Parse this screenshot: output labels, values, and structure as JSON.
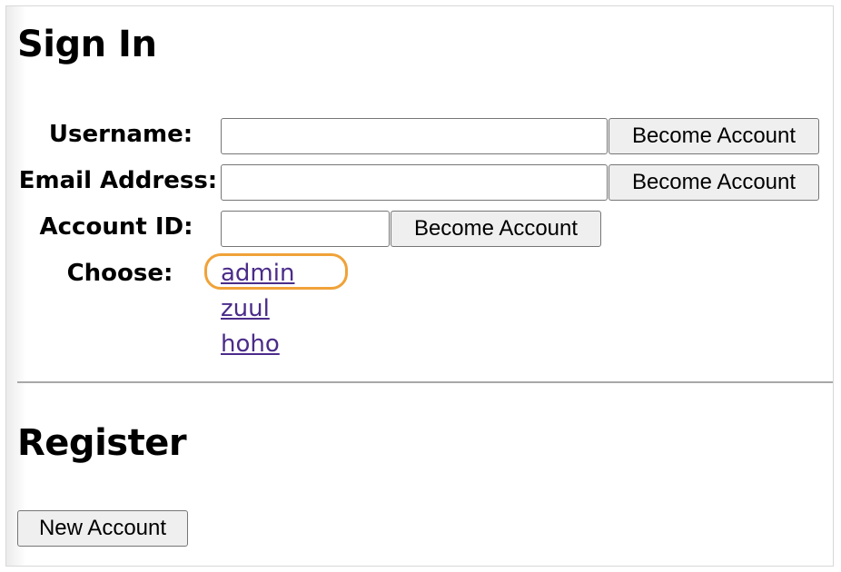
{
  "signin": {
    "title": "Sign In",
    "fields": {
      "username": {
        "label": "Username:",
        "value": "",
        "button": "Become Account"
      },
      "email": {
        "label": "Email Address:",
        "value": "",
        "button": "Become Account"
      },
      "account_id": {
        "label": "Account ID:",
        "value": "",
        "button": "Become Account"
      }
    },
    "choose": {
      "label": "Choose:",
      "options": [
        "admin",
        "zuul",
        "hoho"
      ],
      "highlighted": "admin",
      "highlight_color": "#f0a238"
    }
  },
  "register": {
    "title": "Register",
    "button": "New Account"
  },
  "colors": {
    "link": "#4b2c89",
    "divider": "#a8a8a8",
    "button_bg": "#efefef"
  }
}
